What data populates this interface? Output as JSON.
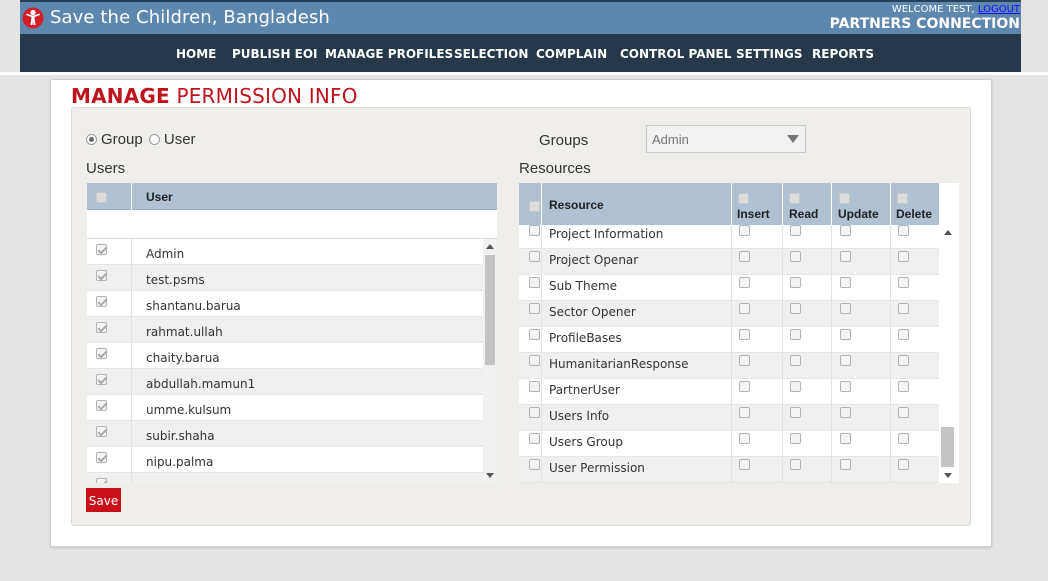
{
  "header": {
    "org_name": "Save the Children, Bangladesh",
    "welcome_text": "WELCOME TEST,",
    "logout_label": "LOGOUT",
    "brand": "PARTNERS CONNECTION"
  },
  "nav": [
    {
      "label": "HOME"
    },
    {
      "label": "PUBLISH EOI"
    },
    {
      "label": "MANAGE PROFILES"
    },
    {
      "label": "SELECTION"
    },
    {
      "label": "COMPLAIN"
    },
    {
      "label": "CONTROL PANEL"
    },
    {
      "label": "SETTINGS"
    },
    {
      "label": "REPORTS"
    }
  ],
  "page": {
    "title_bold": "MANAGE",
    "title_rest": " PERMISSION INFO"
  },
  "mode": {
    "group_label": "Group",
    "user_label": "User",
    "selected": "Group"
  },
  "groups": {
    "label": "Groups",
    "selected": "Admin"
  },
  "users": {
    "section_label": "Users",
    "column_header": "User",
    "rows": [
      {
        "name": "Admin",
        "checked": true
      },
      {
        "name": "test.psms",
        "checked": true
      },
      {
        "name": "shantanu.barua",
        "checked": true
      },
      {
        "name": "rahmat.ullah",
        "checked": true
      },
      {
        "name": "chaity.barua",
        "checked": true
      },
      {
        "name": "abdullah.mamun1",
        "checked": true
      },
      {
        "name": "umme.kulsum",
        "checked": true
      },
      {
        "name": "subir.shaha",
        "checked": true
      },
      {
        "name": "nipu.palma",
        "checked": true
      }
    ]
  },
  "resources": {
    "section_label": "Resources",
    "columns": [
      "Resource",
      "Insert",
      "Read",
      "Update",
      "Delete"
    ],
    "rows": [
      {
        "name": "Project Information"
      },
      {
        "name": "Project Openar"
      },
      {
        "name": "Sub Theme"
      },
      {
        "name": "Sector Opener"
      },
      {
        "name": "ProfileBases"
      },
      {
        "name": "HumanitarianResponse"
      },
      {
        "name": "PartnerUser"
      },
      {
        "name": "Users Info"
      },
      {
        "name": "Users Group"
      },
      {
        "name": "User Permission"
      }
    ]
  },
  "actions": {
    "save_label": "Save"
  },
  "colors": {
    "header_blue": "#5d87ad",
    "nav_dark": "#26384b",
    "accent_red": "#c0141c",
    "table_header": "#afc1d3"
  }
}
